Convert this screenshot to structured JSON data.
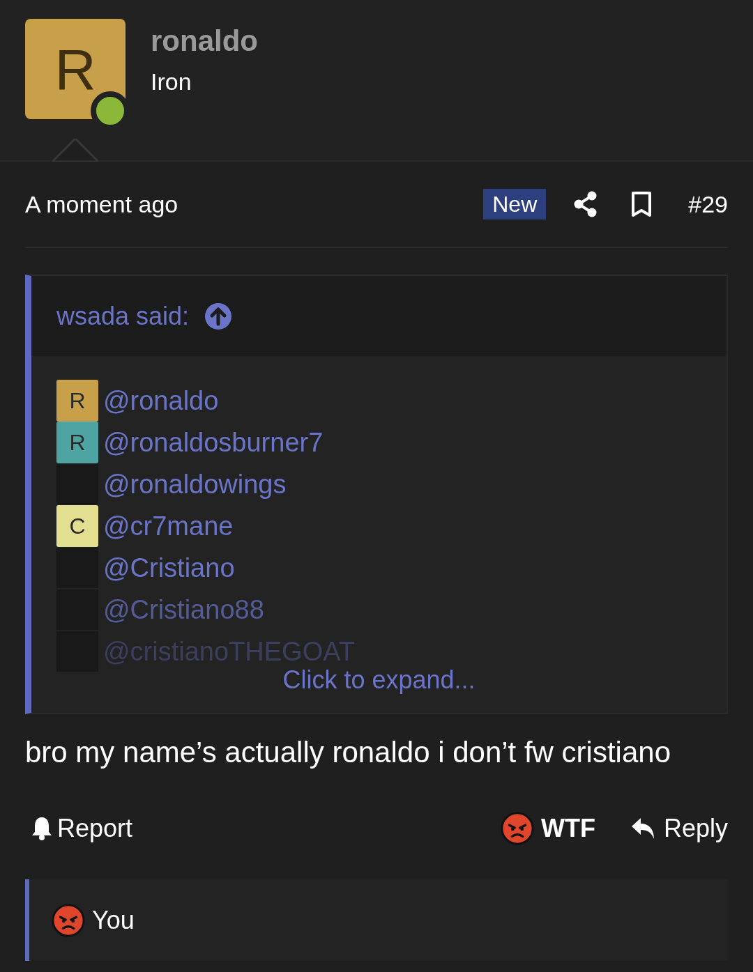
{
  "author": {
    "avatar_letter": "R",
    "online": true,
    "username": "ronaldo",
    "rank": "Iron"
  },
  "post": {
    "time": "A moment ago",
    "badge": "New",
    "number": "#29"
  },
  "quote": {
    "attribution": "wsada said:",
    "mentions": [
      {
        "text": "@ronaldo",
        "avatar_letter": "R",
        "color": "#c9a04a"
      },
      {
        "text": "@ronaldosburner7",
        "avatar_letter": "R",
        "color": "#4ea3a3"
      },
      {
        "text": "@ronaldowings"
      },
      {
        "text": "@cr7mane",
        "avatar_letter": "C",
        "color": "#e2df90"
      },
      {
        "text": "@Cristiano"
      },
      {
        "text": "@Cristiano88"
      },
      {
        "text": "@cristianoTHEGOAT"
      }
    ],
    "expand": "Click to expand..."
  },
  "message": "bro my name’s actually ronaldo i don’t fw cristiano",
  "actions": {
    "report": "Report",
    "reaction": "WTF",
    "reply": "Reply"
  },
  "reactions": {
    "summary": "You"
  }
}
